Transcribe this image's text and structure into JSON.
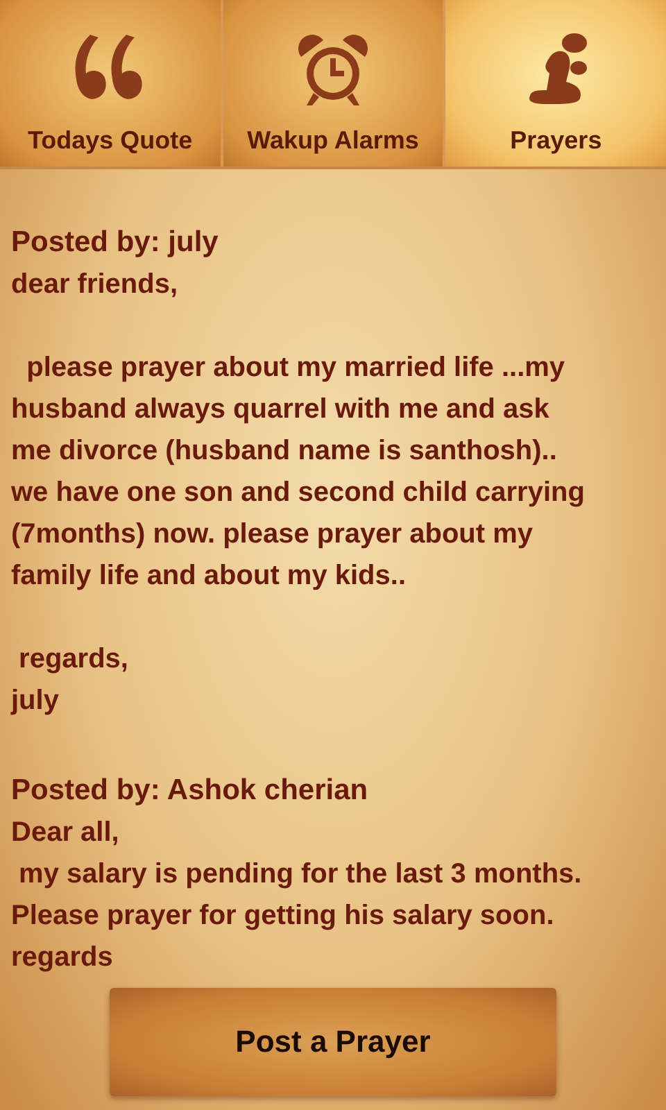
{
  "tabs": [
    {
      "label": "Todays Quote",
      "kind": "quote",
      "selected": false
    },
    {
      "label": "Wakup Alarms",
      "kind": "alarm",
      "selected": false
    },
    {
      "label": "Prayers",
      "kind": "prayer",
      "selected": true
    }
  ],
  "posts": [
    {
      "author": "Posted by: july",
      "body": "dear friends,\n\n  please prayer about my married life ...my\nhusband always quarrel with me and ask\nme divorce (husband name is santhosh)..\nwe have one son and second child carrying\n(7months) now. please prayer about my\nfamily life and about my kids..\n\n regards,\njuly"
    },
    {
      "author": "Posted by: Ashok cherian",
      "body": "Dear all,\n my salary is pending for the last 3 months.\nPlease prayer for getting his salary soon.\nregards"
    }
  ],
  "post_button": "Post a Prayer"
}
